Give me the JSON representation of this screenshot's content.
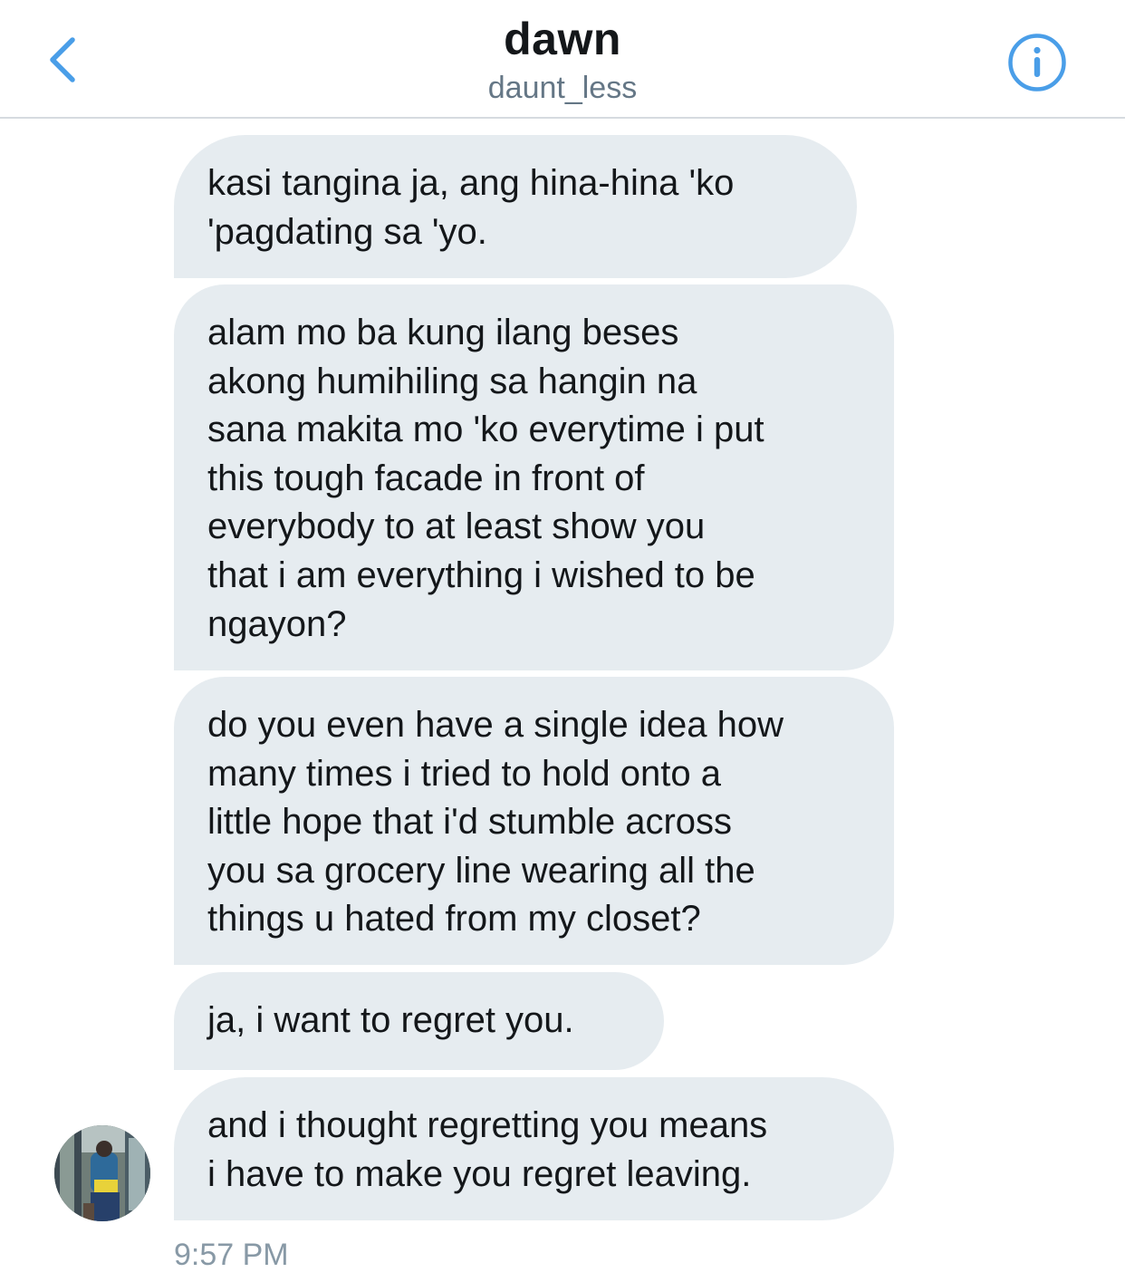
{
  "header": {
    "title": "dawn",
    "handle": "daunt_less",
    "back_icon": "chevron-left-icon",
    "info_icon": "info-circle-icon",
    "accent_color": "#4a9ee8"
  },
  "messages": [
    {
      "lines": [
        "kasi tangina ja, ang hina-hina 'ko",
        "'pagdating sa 'yo."
      ]
    },
    {
      "lines": [
        "alam mo ba kung ilang beses",
        "akong humihiling sa hangin na",
        "sana makita mo 'ko everytime i put",
        "this tough facade in front of",
        "everybody to at least show you",
        "that i am everything i wished to be",
        "ngayon?"
      ]
    },
    {
      "lines": [
        "do you even have a single idea how",
        "many times i tried to hold onto a",
        "little hope that i'd stumble across",
        "you sa grocery line wearing all the",
        "things u hated from my closet?"
      ]
    },
    {
      "lines": [
        "ja, i want to regret you."
      ]
    },
    {
      "lines": [
        "and i thought regretting you means",
        "i have to make you regret leaving."
      ]
    }
  ],
  "timestamp": "9:57 PM",
  "colors": {
    "bubble_bg": "#e6ecf0",
    "text": "#14171a",
    "secondary_text": "#657786",
    "timestamp": "#8899a6"
  }
}
